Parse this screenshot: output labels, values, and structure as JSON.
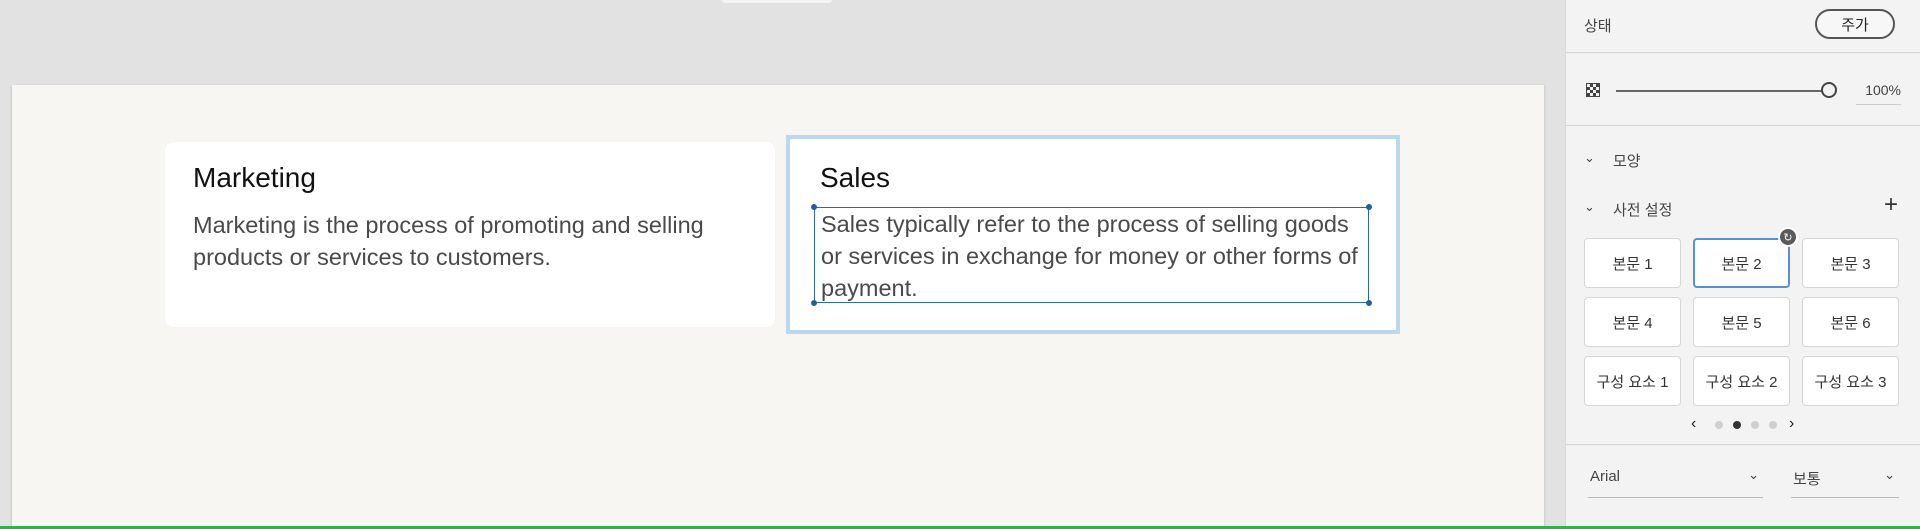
{
  "canvas": {
    "cards": [
      {
        "title": "Marketing",
        "body": "Marketing is the process of promoting and selling products or services to customers."
      },
      {
        "title": "Sales",
        "body": "Sales typically refer to the process of selling goods or services in exchange for money or other forms of payment."
      }
    ]
  },
  "panel": {
    "state_label": "상태",
    "add_state_label": "주가",
    "opacity_value": "100%",
    "opacity_level": 1.0,
    "appearance_label": "모양",
    "presets_label": "사전 설정",
    "add_preset_icon": "+",
    "presets": [
      "본문 1",
      "본문 2",
      "본문 3",
      "본문 4",
      "본문 5",
      "본문 6",
      "구성 요소 1",
      "구성 요소 2",
      "구성 요소 3"
    ],
    "selected_preset": "본문 2",
    "pager": {
      "pages": 4,
      "current": 2
    },
    "font_family": "Arial",
    "font_weight": "보통"
  },
  "colors": {
    "selection_outline": "#bcd8ec",
    "selection_box": "#2b6aa8",
    "preset_selected": "#5a8ed6",
    "status_strip": "#2fb24c"
  }
}
